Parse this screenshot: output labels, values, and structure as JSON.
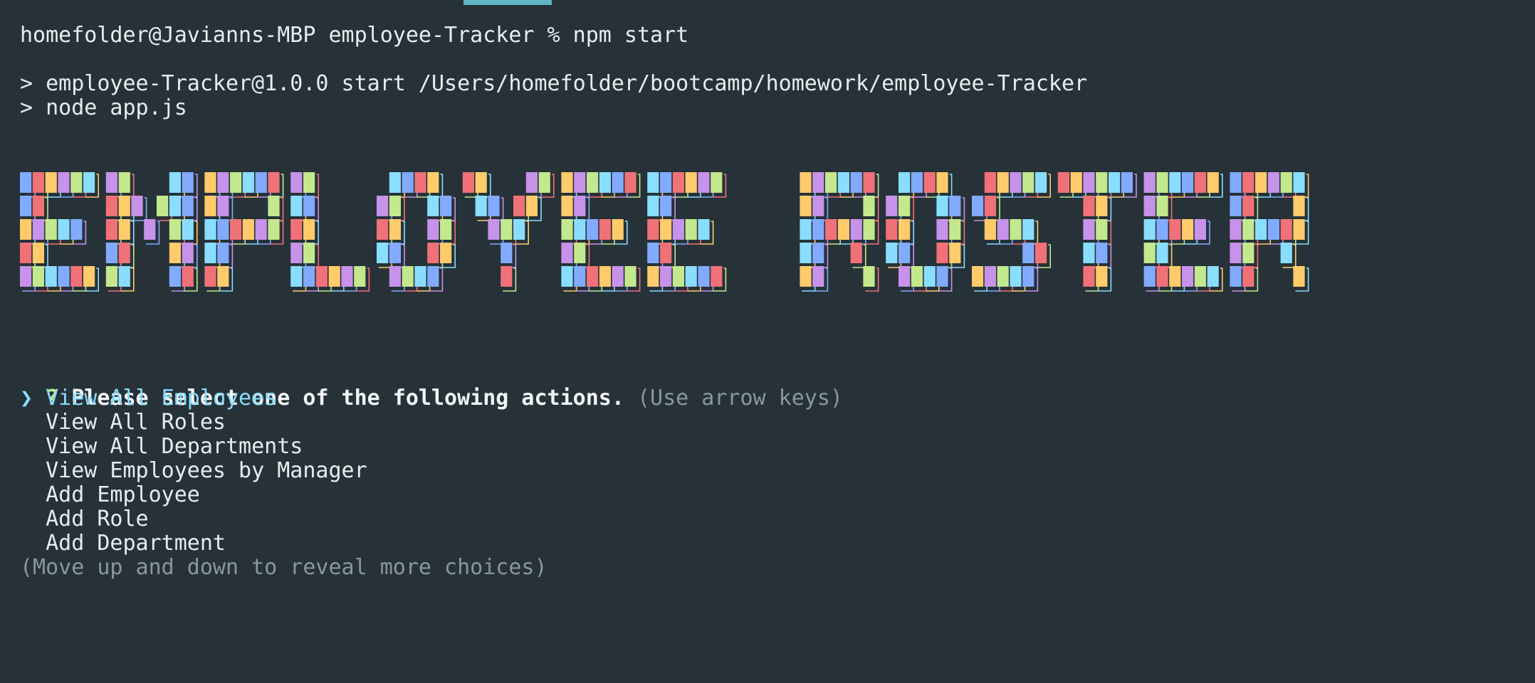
{
  "terminal": {
    "prompt_line": "homefolder@Javianns-MBP employee-Tracker % npm start",
    "script_line": "> employee-Tracker@1.0.0 start /Users/homefolder/bootcamp/homework/employee-Tracker",
    "node_line": "> node app.js"
  },
  "banner": {
    "text": "EMPLOYEE ROSTER",
    "colors": [
      "#82aaff",
      "#f07178",
      "#ffcb6b",
      "#c792ea",
      "#c3e88d",
      "#89ddff"
    ]
  },
  "prompt": {
    "marker": "?",
    "question": "Please select one of the following actions.",
    "help": "(Use arrow keys)",
    "pointer": "❯",
    "choices": [
      "View All Employees",
      "View All Roles",
      "View All Departments",
      "View Employees by Manager",
      "Add Employee",
      "Add Role",
      "Add Department"
    ],
    "more_hint": "(Move up and down to reveal more choices)"
  }
}
